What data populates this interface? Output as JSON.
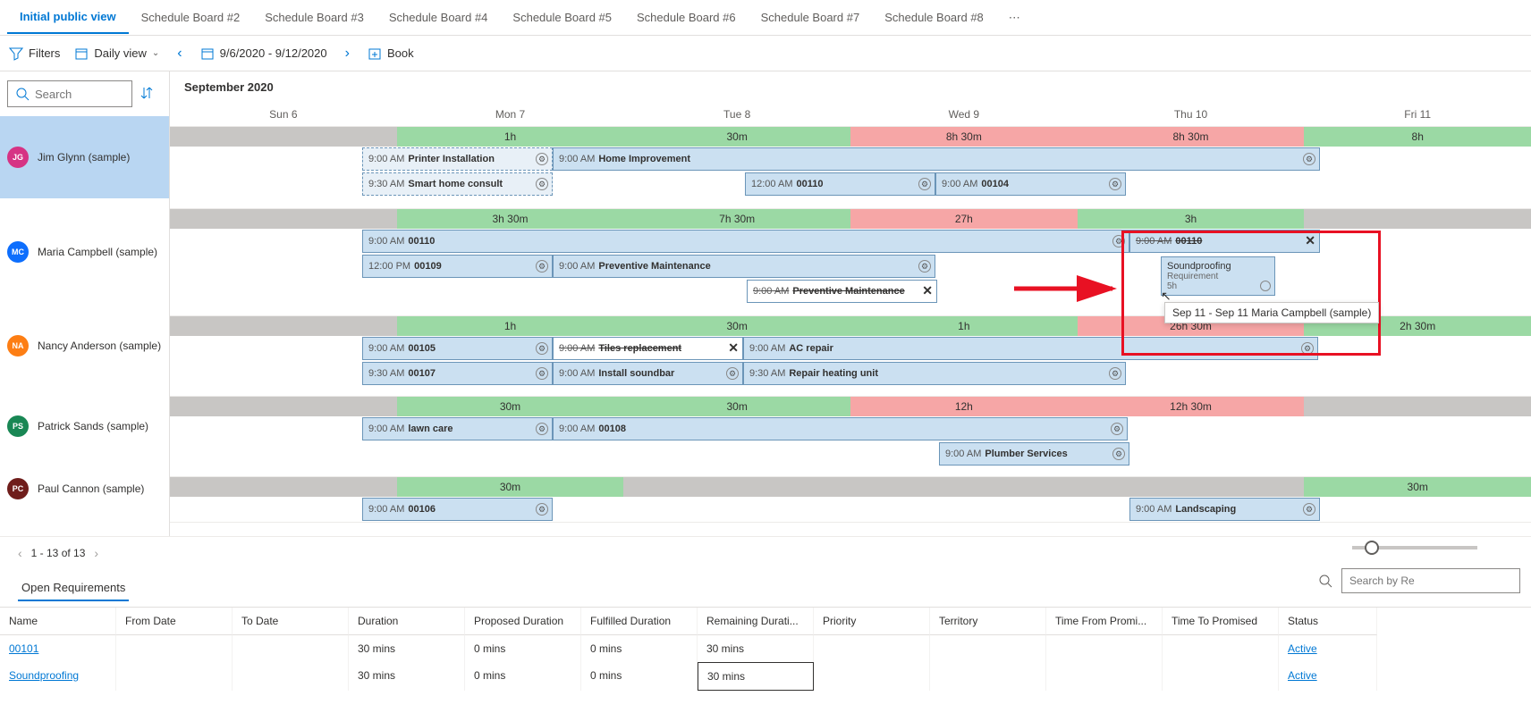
{
  "tabs": [
    "Initial public view",
    "Schedule Board #2",
    "Schedule Board #3",
    "Schedule Board #4",
    "Schedule Board #5",
    "Schedule Board #6",
    "Schedule Board #7",
    "Schedule Board #8"
  ],
  "toolbar": {
    "filters": "Filters",
    "view": "Daily view",
    "range": "9/6/2020 - 9/12/2020",
    "book": "Book"
  },
  "search": {
    "placeholder": "Search"
  },
  "month": "September 2020",
  "days": [
    "Sun 6",
    "Mon 7",
    "Tue 8",
    "Wed 9",
    "Thu 10",
    "Fri 11"
  ],
  "resources": [
    {
      "initials": "JG",
      "color": "#d63384",
      "name": "Jim Glynn (sample)",
      "summary": [
        [
          "gray",
          ""
        ],
        [
          "g",
          "1h"
        ],
        [
          "g",
          "30m"
        ],
        [
          "r",
          "8h 30m"
        ],
        [
          "r",
          "8h 30m"
        ],
        [
          "g",
          "8h"
        ]
      ]
    },
    {
      "initials": "MC",
      "color": "#0d6efd",
      "name": "Maria Campbell (sample)",
      "summary": [
        [
          "gray",
          ""
        ],
        [
          "g",
          "3h 30m"
        ],
        [
          "g",
          "7h 30m"
        ],
        [
          "r",
          "27h"
        ],
        [
          "g",
          "3h"
        ],
        [
          "gray",
          ""
        ]
      ]
    },
    {
      "initials": "NA",
      "color": "#fd7e14",
      "name": "Nancy Anderson (sample)",
      "summary": [
        [
          "gray",
          ""
        ],
        [
          "g",
          "1h"
        ],
        [
          "g",
          "30m"
        ],
        [
          "g",
          "1h"
        ],
        [
          "r",
          "26h 30m"
        ],
        [
          "g",
          "2h 30m"
        ]
      ]
    },
    {
      "initials": "PS",
      "color": "#198754",
      "name": "Patrick Sands (sample)",
      "summary": [
        [
          "gray",
          ""
        ],
        [
          "g",
          "30m"
        ],
        [
          "g",
          "30m"
        ],
        [
          "r",
          "12h"
        ],
        [
          "r",
          "12h 30m"
        ],
        [
          "gray",
          ""
        ]
      ]
    },
    {
      "initials": "PC",
      "color": "#6f1d1b",
      "name": "Paul Cannon (sample)",
      "summary": [
        [
          "gray",
          ""
        ],
        [
          "g",
          "30m"
        ],
        [
          "gray",
          ""
        ],
        [
          "gray",
          ""
        ],
        [
          "gray",
          ""
        ],
        [
          "g",
          "30m"
        ]
      ]
    }
  ],
  "events": {
    "jg": [
      [
        {
          "start": 1,
          "span": 1,
          "time": "9:00 AM",
          "title": "Printer Installation",
          "dashed": true
        },
        {
          "start": 2,
          "span": 4,
          "time": "9:00 AM",
          "title": "Home Improvement"
        }
      ],
      [
        {
          "start": 1,
          "span": 1,
          "time": "9:30 AM",
          "title": "Smart home consult",
          "dashed": true
        },
        {
          "start": 3,
          "span": 1,
          "time": "12:00 AM",
          "title": "00110"
        },
        {
          "start": 4,
          "span": 1,
          "time": "9:00 AM",
          "title": "00104"
        }
      ]
    ],
    "mc": [
      [
        {
          "start": 1,
          "span": 4,
          "time": "9:00 AM",
          "title": "00110"
        },
        {
          "start": 5,
          "span": 1,
          "time": "9:00 AM",
          "title": "00110",
          "strike": true,
          "x": true
        }
      ],
      [
        {
          "start": 1,
          "span": 1,
          "time": "12:00 PM",
          "title": "00109"
        },
        {
          "start": 2,
          "span": 2,
          "time": "9:00 AM",
          "title": "Preventive Maintenance"
        }
      ],
      [
        {
          "start": 3,
          "span": 1,
          "time": "9:00 AM",
          "title": "Preventive Maintenance",
          "strike": true,
          "white": true,
          "x": true
        }
      ]
    ],
    "na": [
      [
        {
          "start": 1,
          "span": 1,
          "time": "9:00 AM",
          "title": "00105"
        },
        {
          "start": 2,
          "span": 1,
          "time": "9:00 AM",
          "title": "Tiles replacement",
          "strike": true,
          "white": true,
          "x": true
        },
        {
          "start": 3,
          "span": 3,
          "time": "9:00 AM",
          "title": "AC repair"
        }
      ],
      [
        {
          "start": 1,
          "span": 1,
          "time": "9:30 AM",
          "title": "00107"
        },
        {
          "start": 2,
          "span": 1,
          "time": "9:00 AM",
          "title": "Install soundbar"
        },
        {
          "start": 3,
          "span": 2,
          "time": "9:30 AM",
          "title": "Repair heating unit"
        }
      ]
    ],
    "ps": [
      [
        {
          "start": 1,
          "span": 1,
          "time": "9:00 AM",
          "title": "lawn care"
        },
        {
          "start": 2,
          "span": 3,
          "time": "9:00 AM",
          "title": "00108"
        }
      ],
      [
        {
          "start": 4,
          "span": 1,
          "time": "9:00 AM",
          "title": "Plumber Services"
        }
      ]
    ],
    "pc": [
      [
        {
          "start": 1,
          "span": 1,
          "time": "9:00 AM",
          "title": "00106"
        },
        {
          "start": 5,
          "span": 1,
          "time": "9:00 AM",
          "title": "Landscaping"
        }
      ]
    ]
  },
  "drag": {
    "title": "Soundproofing",
    "subtitle": "Requirement",
    "dur": "5h"
  },
  "tooltip": "Sep 11 - Sep 11 Maria Campbell (sample)",
  "pager": "1 - 13 of 13",
  "bottom": {
    "tab": "Open Requirements",
    "searchPH": "Search by Re"
  },
  "grid": {
    "headers": [
      "Name",
      "From Date",
      "To Date",
      "Duration",
      "Proposed Duration",
      "Fulfilled Duration",
      "Remaining Durati...",
      "Priority",
      "Territory",
      "Time From Promi...",
      "Time To Promised",
      "Status"
    ],
    "rows": [
      {
        "name": "00101",
        "dur": "30 mins",
        "prop": "0 mins",
        "ful": "0 mins",
        "rem": "30 mins",
        "status": "Active"
      },
      {
        "name": "Soundproofing",
        "dur": "30 mins",
        "prop": "0 mins",
        "ful": "0 mins",
        "rem": "30 mins",
        "status": "Active"
      }
    ]
  }
}
